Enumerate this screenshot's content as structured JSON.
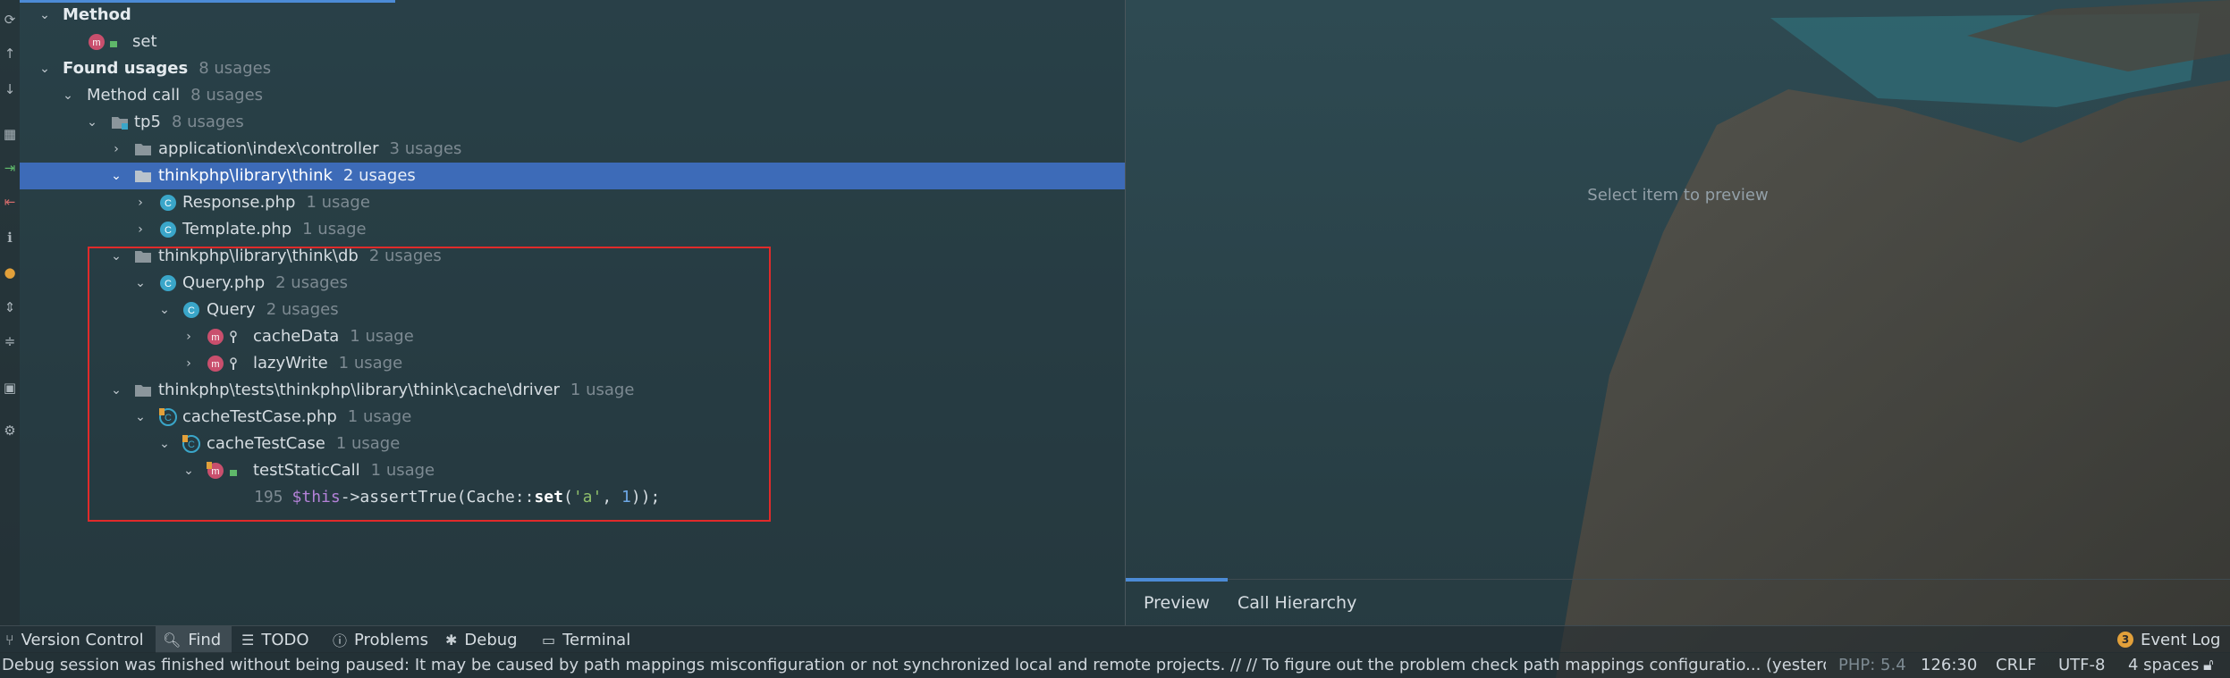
{
  "tree": {
    "method_group": {
      "label": "Method"
    },
    "method_set": {
      "label": "set"
    },
    "found_usages": {
      "label": "Found usages",
      "count": "8 usages"
    },
    "method_call": {
      "label": "Method call",
      "count": "8 usages"
    },
    "tp5": {
      "label": "tp5",
      "count": "8 usages"
    },
    "app_index_controller": {
      "label": "application\\index\\controller",
      "count": "3 usages"
    },
    "think_dir": {
      "label": "thinkphp\\library\\think",
      "count": "2 usages"
    },
    "response_php": {
      "label": "Response.php",
      "count": "1 usage"
    },
    "template_php": {
      "label": "Template.php",
      "count": "1 usage"
    },
    "think_db_dir": {
      "label": "thinkphp\\library\\think\\db",
      "count": "2 usages"
    },
    "query_php": {
      "label": "Query.php",
      "count": "2 usages"
    },
    "query_class": {
      "label": "Query",
      "count": "2 usages"
    },
    "cache_data": {
      "label": "cacheData",
      "count": "1 usage"
    },
    "lazy_write": {
      "label": "lazyWrite",
      "count": "1 usage"
    },
    "tests_driver_dir": {
      "label": "thinkphp\\tests\\thinkphp\\library\\think\\cache\\driver",
      "count": "1 usage"
    },
    "cache_test_case_php": {
      "label": "cacheTestCase.php",
      "count": "1 usage"
    },
    "cache_test_case_class": {
      "label": "cacheTestCase",
      "count": "1 usage"
    },
    "test_static_call": {
      "label": "testStaticCall",
      "count": "1 usage"
    },
    "code_line": {
      "line_no": "195",
      "this": "$this",
      "arrow": "->",
      "call": "assertTrue(Cache::",
      "method": "set",
      "open": "(",
      "str": "'a'",
      "sep": ", ",
      "num": "1",
      "close": "));"
    }
  },
  "preview": {
    "empty_text": "Select item to preview",
    "tabs": [
      {
        "label": "Preview"
      },
      {
        "label": "Call Hierarchy"
      }
    ]
  },
  "tool_windows": {
    "version_control": "Version Control",
    "find": "Find",
    "todo": "TODO",
    "problems": "Problems",
    "debug": "Debug",
    "terminal": "Terminal",
    "event_log": "Event Log",
    "event_log_count": "3"
  },
  "status": {
    "message": "Debug session was finished without being paused: It may be caused by path mappings misconfiguration or not synchronized local and remote projects. // // To figure out the problem check path mappings configuratio... (yesterday 13:",
    "php_version": "PHP: 5.4",
    "position": "126:30",
    "line_sep": "CRLF",
    "encoding": "UTF-8",
    "indent": "4 spaces"
  },
  "colors": {
    "selection": "#3d6bb8",
    "highlight_box": "#e02a2a",
    "accent_tab": "#4c8bd6",
    "method_icon": "#c94f6d",
    "class_icon": "#3aa6c9"
  },
  "icons": [
    "refresh-icon",
    "arrow-up-icon",
    "arrow-down-icon",
    "group-icon",
    "merge-icon",
    "exclude-icon",
    "info-icon",
    "php-icon",
    "expand-all-icon",
    "collapse-all-icon",
    "preview-icon",
    "gear-icon",
    "search-icon",
    "list-icon",
    "warning-icon",
    "bug-icon",
    "terminal-icon",
    "lock-icon",
    "folder-icon",
    "class-icon",
    "method-icon"
  ]
}
